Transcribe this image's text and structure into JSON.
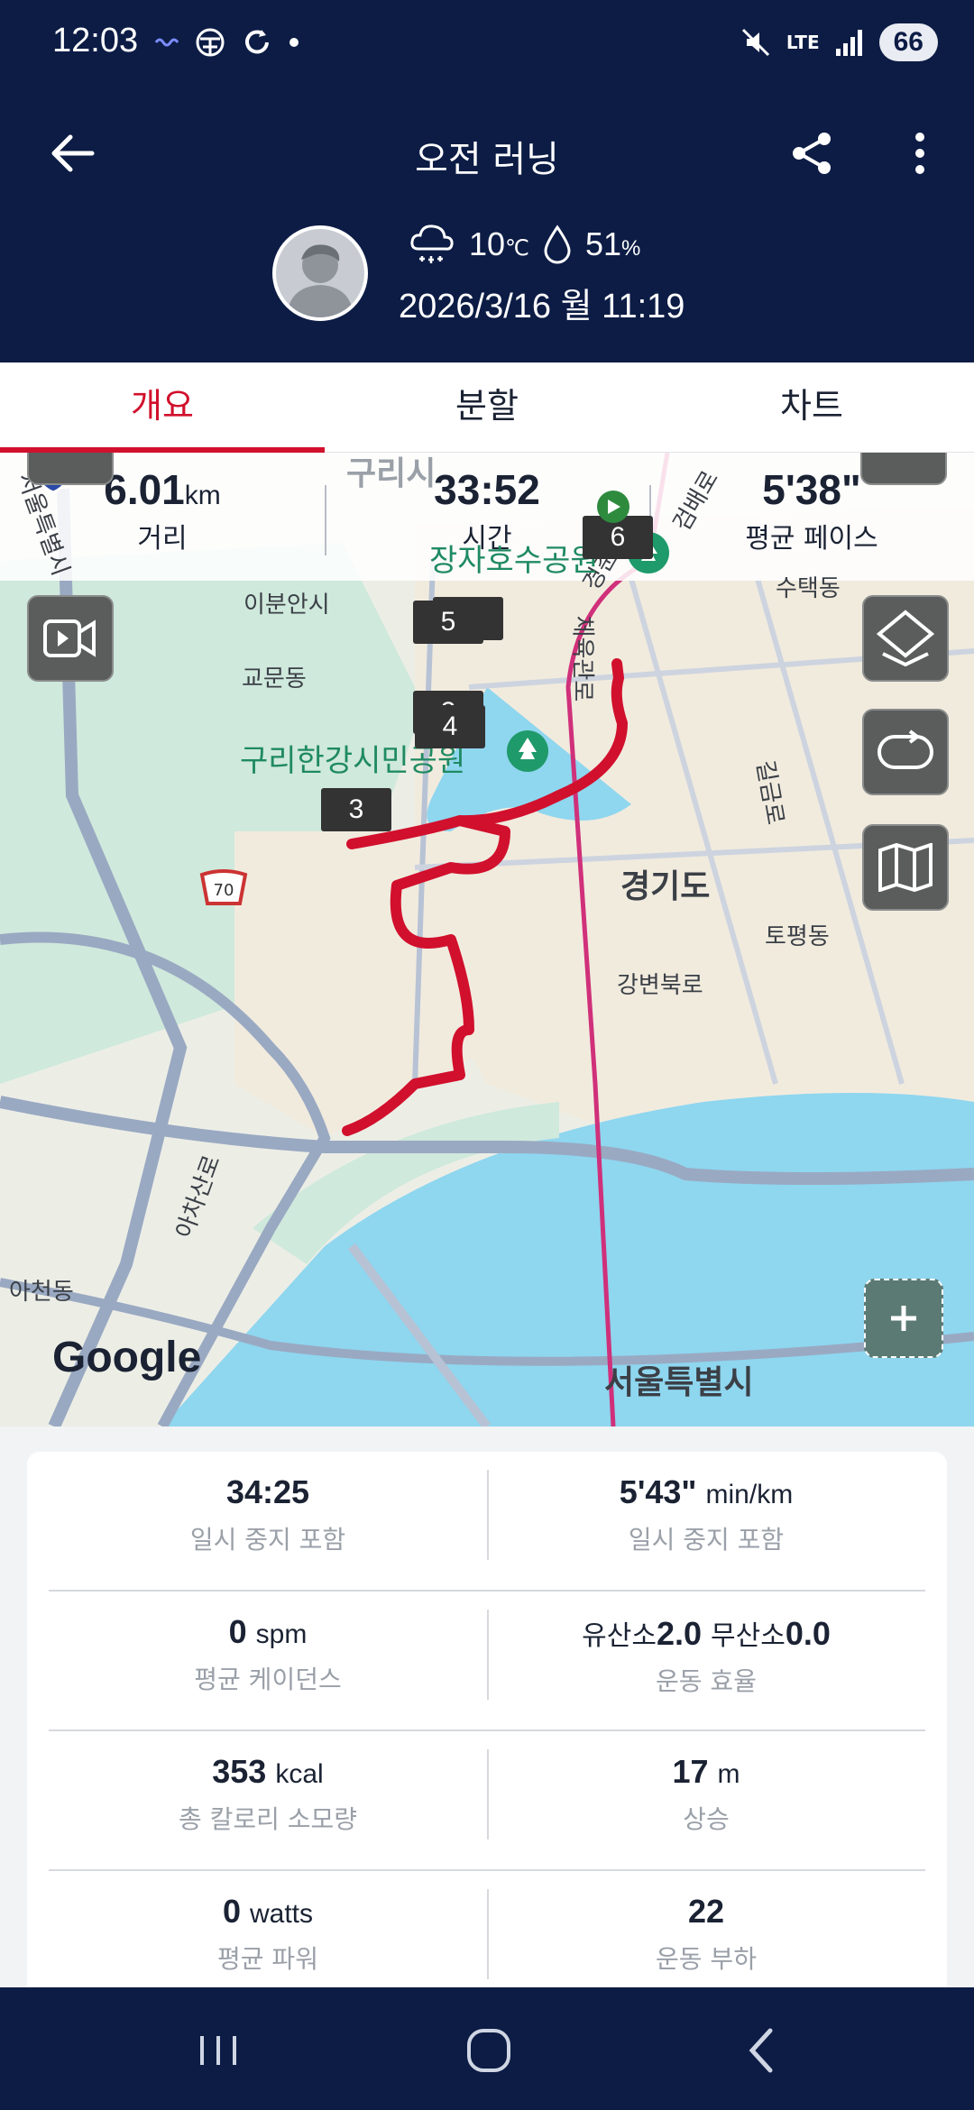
{
  "status_bar": {
    "time": "12:03",
    "network": "LTE",
    "battery": "66"
  },
  "header": {
    "title": "오전 러닝",
    "weather": {
      "temp": "10",
      "temp_unit": "℃",
      "humidity": "51",
      "humidity_unit": "%"
    },
    "datetime": "2026/3/16 월 11:19"
  },
  "tabs": [
    {
      "label": "개요",
      "active": true
    },
    {
      "label": "분할",
      "active": false
    },
    {
      "label": "차트",
      "active": false
    }
  ],
  "summary": [
    {
      "value": "6.01",
      "unit": "km",
      "label": "거리"
    },
    {
      "value": "33:52",
      "unit": "",
      "label": "시간"
    },
    {
      "value": "5'38\"",
      "unit": "",
      "label": "평균 페이스"
    }
  ],
  "map": {
    "places": {
      "guri": "구리시",
      "gyomun": "교문동",
      "sutaek": "수택동",
      "topyeong": "토평동",
      "acheon": "아천동",
      "ebunan": "이분안시",
      "chejukgwanro": "체육관로",
      "gyeongchun": "경춘로",
      "gangbyeon": "강변북로",
      "achasanro": "아차산로",
      "geumgang": "검배로",
      "gilgeum": "길금로",
      "seoul_side": "서울특별시",
      "gyeonggi": "경기도",
      "seoul": "서울특별시"
    },
    "parks": {
      "jangja": "장자호수공원",
      "guri_hangang": "구리한강시민공원"
    },
    "highway_badges": [
      "29",
      "70"
    ],
    "split_markers": [
      "1",
      "2",
      "3",
      "4",
      "5",
      "6"
    ],
    "attribution": "Google",
    "colors": {
      "route": "#d1102d",
      "water": "#8fd6ef",
      "park": "#cfe9dc",
      "urban": "#f1ebde"
    }
  },
  "details": [
    {
      "value": "34:25",
      "unit": "",
      "label": "일시 중지 포함"
    },
    {
      "value": "5'43\"",
      "unit": "min/km",
      "label": "일시 중지 포함"
    },
    {
      "value": "0",
      "unit": "spm",
      "label": "평균 케이던스"
    },
    {
      "value_prefix": "유산소",
      "value": "2.0",
      "value_prefix2": "무산소",
      "value2": "0.0",
      "label": "운동 효율"
    },
    {
      "value": "353",
      "unit": "kcal",
      "label": "총 칼로리 소모량"
    },
    {
      "value": "17",
      "unit": "m",
      "label": "상승"
    },
    {
      "value": "0",
      "unit": "watts",
      "label": "평균 파워"
    },
    {
      "value": "22",
      "unit": "",
      "label": "운동 부하"
    }
  ]
}
